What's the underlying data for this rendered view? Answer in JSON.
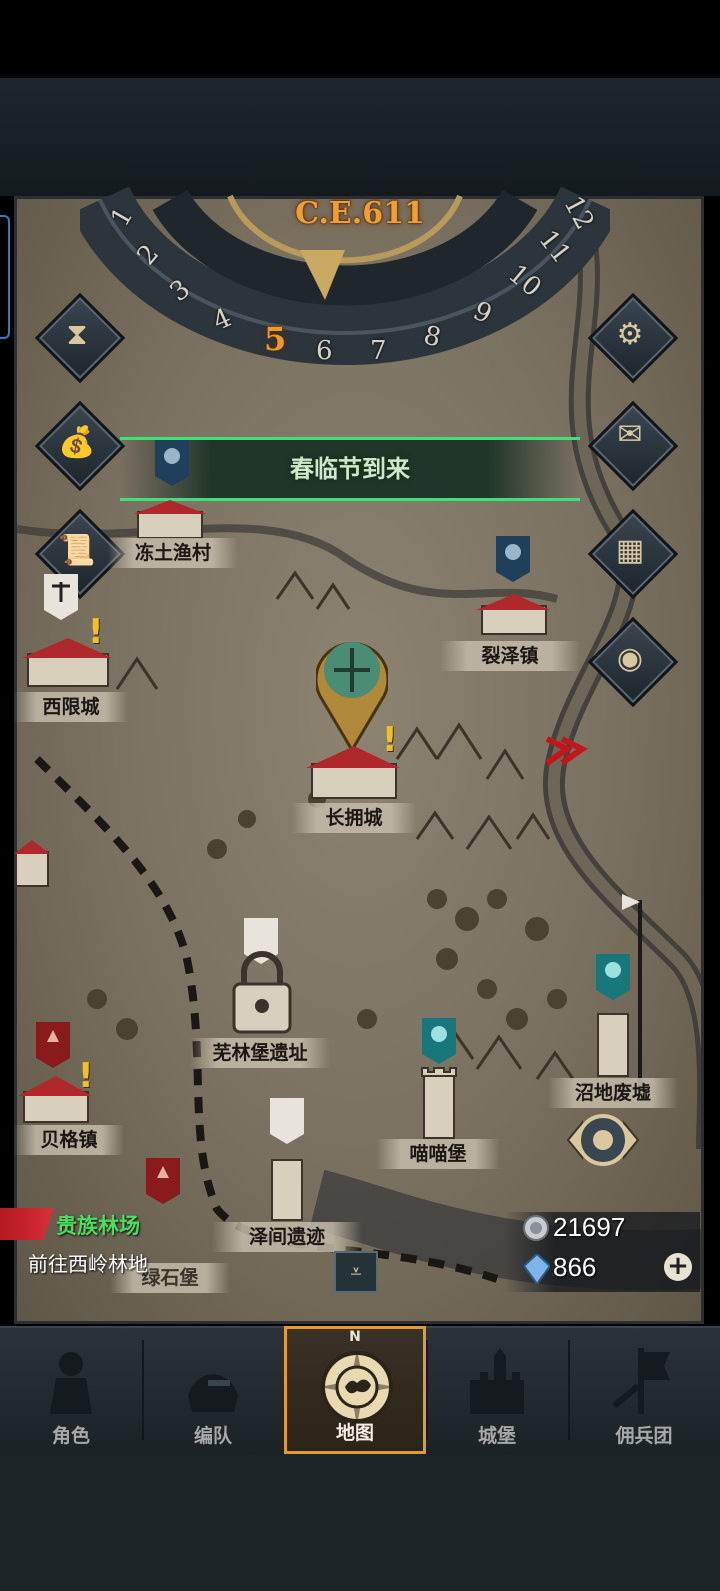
{
  "era": "C.E.611",
  "months": [
    "1",
    "2",
    "3",
    "4",
    "5",
    "6",
    "7",
    "8",
    "9",
    "10",
    "11",
    "12"
  ],
  "current_month": "5",
  "event_banner": "春临节到来",
  "locations": {
    "dongtu": "冻土渔村",
    "liezhe": "裂泽镇",
    "xixian": "西限城",
    "changyong": "长拥城",
    "wulin": "芜林堡遗址",
    "zhaodi": "沼地废墟",
    "miaomiao": "喵喵堡",
    "beige": "贝格镇",
    "zejian": "泽间遗迹",
    "lvshi": "绿石堡"
  },
  "quest": {
    "title": "贵族林场",
    "subtitle": "前往西岭林地"
  },
  "resources": {
    "silver": "21697",
    "crystal": "866"
  },
  "nav": {
    "tabs": [
      {
        "label": "角色",
        "icon": "knight-icon"
      },
      {
        "label": "编队",
        "icon": "helmet-icon"
      },
      {
        "label": "地图",
        "icon": "compass-map-icon",
        "active": true
      },
      {
        "label": "城堡",
        "icon": "castle-icon"
      },
      {
        "label": "佣兵团",
        "icon": "mercenary-banner-icon"
      }
    ],
    "compass_letter": "N"
  },
  "side_buttons": {
    "left": [
      "hourglass-icon",
      "bag-icon",
      "scroll-icon"
    ],
    "right": [
      "gear-icon",
      "mail-icon",
      "grid-icon",
      "coin-icon"
    ]
  },
  "colors": {
    "accent_orange": "#f29a20",
    "banner_green": "#3ee07a",
    "quest_green": "#49e05a",
    "active_tab_border": "#e39b2a"
  }
}
